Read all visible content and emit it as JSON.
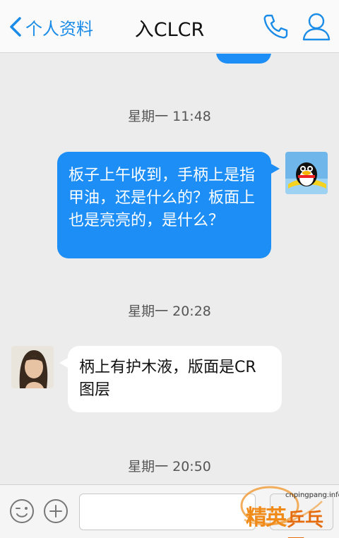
{
  "header": {
    "back_label": "个人资料",
    "title": "入CLCR"
  },
  "chat": {
    "messages": [
      {
        "timestamp": "星期一 11:48",
        "direction": "outgoing",
        "text": "板子上午收到，手柄上是指甲油，还是什么的？板面上也是亮亮的，是什么？"
      },
      {
        "timestamp": "星期一 20:28",
        "direction": "incoming",
        "text": "柄上有护木液，版面是CR图层"
      },
      {
        "timestamp": "星期一 20:50"
      }
    ]
  },
  "input": {
    "value": "",
    "placeholder": ""
  },
  "watermark": {
    "url": "cnpingpang.info",
    "text_a": "精英",
    "text_b": "乒乓网"
  },
  "colors": {
    "accent": "#1a8ce8",
    "outgoing_bubble": "#1d8ef5",
    "background": "#ececec"
  },
  "icons": [
    "chevron-left-icon",
    "phone-icon",
    "user-profile-icon",
    "emoji-icon",
    "plus-icon"
  ]
}
